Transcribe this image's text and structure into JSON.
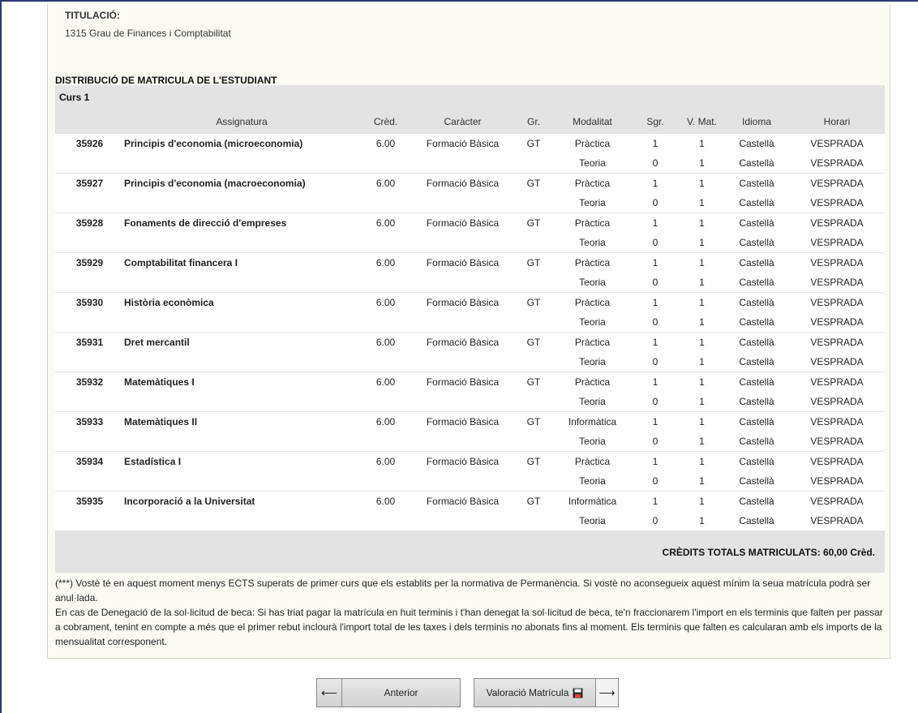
{
  "titulacio": {
    "label": "TITULACIÓ:",
    "value": "1315 Grau de Finances i Comptabilitat"
  },
  "distribution": {
    "title": "DISTRIBUCIÓ DE MATRICULA DE L'ESTUDIANT",
    "course_label": "Curs 1",
    "headers": {
      "assignatura": "Assignatura",
      "cred": "Crèd.",
      "caracter": "Caràcter",
      "gr": "Gr.",
      "modalitat": "Modalitat",
      "sgr": "Sgr.",
      "vmat": "V. Mat.",
      "idioma": "Idioma",
      "horari": "Horari"
    },
    "subjects": [
      {
        "code": "35926",
        "name": "Principis d'economia (microeconomia)",
        "cred": "6.00",
        "caracter": "Formació Bàsica",
        "gr": "GT",
        "rows": [
          {
            "mod": "Pràctica",
            "sgr": "1",
            "vmat": "1",
            "idioma": "Castellà",
            "horari": "VESPRADA"
          },
          {
            "mod": "Teoria",
            "sgr": "0",
            "vmat": "1",
            "idioma": "Castellà",
            "horari": "VESPRADA"
          }
        ]
      },
      {
        "code": "35927",
        "name": "Principis d'economia (macroeconomia)",
        "cred": "6.00",
        "caracter": "Formació Bàsica",
        "gr": "GT",
        "rows": [
          {
            "mod": "Pràctica",
            "sgr": "1",
            "vmat": "1",
            "idioma": "Castellà",
            "horari": "VESPRADA"
          },
          {
            "mod": "Teoria",
            "sgr": "0",
            "vmat": "1",
            "idioma": "Castellà",
            "horari": "VESPRADA"
          }
        ]
      },
      {
        "code": "35928",
        "name": "Fonaments de direcció d'empreses",
        "cred": "6.00",
        "caracter": "Formació Bàsica",
        "gr": "GT",
        "rows": [
          {
            "mod": "Pràctica",
            "sgr": "1",
            "vmat": "1",
            "idioma": "Castellà",
            "horari": "VESPRADA"
          },
          {
            "mod": "Teoria",
            "sgr": "0",
            "vmat": "1",
            "idioma": "Castellà",
            "horari": "VESPRADA"
          }
        ]
      },
      {
        "code": "35929",
        "name": "Comptabilitat financera I",
        "cred": "6.00",
        "caracter": "Formació Bàsica",
        "gr": "GT",
        "rows": [
          {
            "mod": "Pràctica",
            "sgr": "1",
            "vmat": "1",
            "idioma": "Castellà",
            "horari": "VESPRADA"
          },
          {
            "mod": "Teoria",
            "sgr": "0",
            "vmat": "1",
            "idioma": "Castellà",
            "horari": "VESPRADA"
          }
        ]
      },
      {
        "code": "35930",
        "name": "Història econòmica",
        "cred": "6.00",
        "caracter": "Formació Bàsica",
        "gr": "GT",
        "rows": [
          {
            "mod": "Pràctica",
            "sgr": "1",
            "vmat": "1",
            "idioma": "Castellà",
            "horari": "VESPRADA"
          },
          {
            "mod": "Teoria",
            "sgr": "0",
            "vmat": "1",
            "idioma": "Castellà",
            "horari": "VESPRADA"
          }
        ]
      },
      {
        "code": "35931",
        "name": "Dret mercantil",
        "cred": "6.00",
        "caracter": "Formació Bàsica",
        "gr": "GT",
        "rows": [
          {
            "mod": "Pràctica",
            "sgr": "1",
            "vmat": "1",
            "idioma": "Castellà",
            "horari": "VESPRADA"
          },
          {
            "mod": "Teoria",
            "sgr": "0",
            "vmat": "1",
            "idioma": "Castellà",
            "horari": "VESPRADA"
          }
        ]
      },
      {
        "code": "35932",
        "name": "Matemàtiques I",
        "cred": "6.00",
        "caracter": "Formació Bàsica",
        "gr": "GT",
        "rows": [
          {
            "mod": "Pràctica",
            "sgr": "1",
            "vmat": "1",
            "idioma": "Castellà",
            "horari": "VESPRADA"
          },
          {
            "mod": "Teoria",
            "sgr": "0",
            "vmat": "1",
            "idioma": "Castellà",
            "horari": "VESPRADA"
          }
        ]
      },
      {
        "code": "35933",
        "name": "Matemàtiques II",
        "cred": "6.00",
        "caracter": "Formació Bàsica",
        "gr": "GT",
        "rows": [
          {
            "mod": "Informàtica",
            "sgr": "1",
            "vmat": "1",
            "idioma": "Castellà",
            "horari": "VESPRADA"
          },
          {
            "mod": "Teoria",
            "sgr": "0",
            "vmat": "1",
            "idioma": "Castellà",
            "horari": "VESPRADA"
          }
        ]
      },
      {
        "code": "35934",
        "name": "Estadística I",
        "cred": "6.00",
        "caracter": "Formació Bàsica",
        "gr": "GT",
        "rows": [
          {
            "mod": "Pràctica",
            "sgr": "1",
            "vmat": "1",
            "idioma": "Castellà",
            "horari": "VESPRADA"
          },
          {
            "mod": "Teoria",
            "sgr": "0",
            "vmat": "1",
            "idioma": "Castellà",
            "horari": "VESPRADA"
          }
        ]
      },
      {
        "code": "35935",
        "name": "Incorporació a la Universitat",
        "cred": "6.00",
        "caracter": "Formació Bàsica",
        "gr": "GT",
        "rows": [
          {
            "mod": "Informàtica",
            "sgr": "1",
            "vmat": "1",
            "idioma": "Castellà",
            "horari": "VESPRADA"
          },
          {
            "mod": "Teoria",
            "sgr": "0",
            "vmat": "1",
            "idioma": "Castellà",
            "horari": "VESPRADA"
          }
        ]
      }
    ],
    "totals": "CRÈDITS TOTALS MATRICULATS:  60,00  Crèd."
  },
  "notes": {
    "note1": "(***) Vostè té en aquest moment menys ECTS superats de primer curs que els establits per la normativa de Permanència. Si vostè no aconsegueix aquest mínim la seua matrícula podrà ser anul·lada.",
    "note2": "En cas de Denegació de la sol·licitud de beca: Si has triat pagar la matrícula en huit terminis i t'han denegat la sol·licitud de beca, te'n fraccionarem l'import en els terminis que falten per passar a cobrament, tenint en compte a més que el primer rebut inclourà l'import total de les taxes i dels terminis no abonats fins al moment. Els terminis que falten es calcularan amb els imports de la mensualitat corresponent."
  },
  "buttons": {
    "prev_arrow": "⟵",
    "prev_label": "Anterior",
    "next_label": "Valoració Matrícula",
    "next_arrow": "⟶",
    "floppy_icon": "floppy-disk-icon"
  }
}
